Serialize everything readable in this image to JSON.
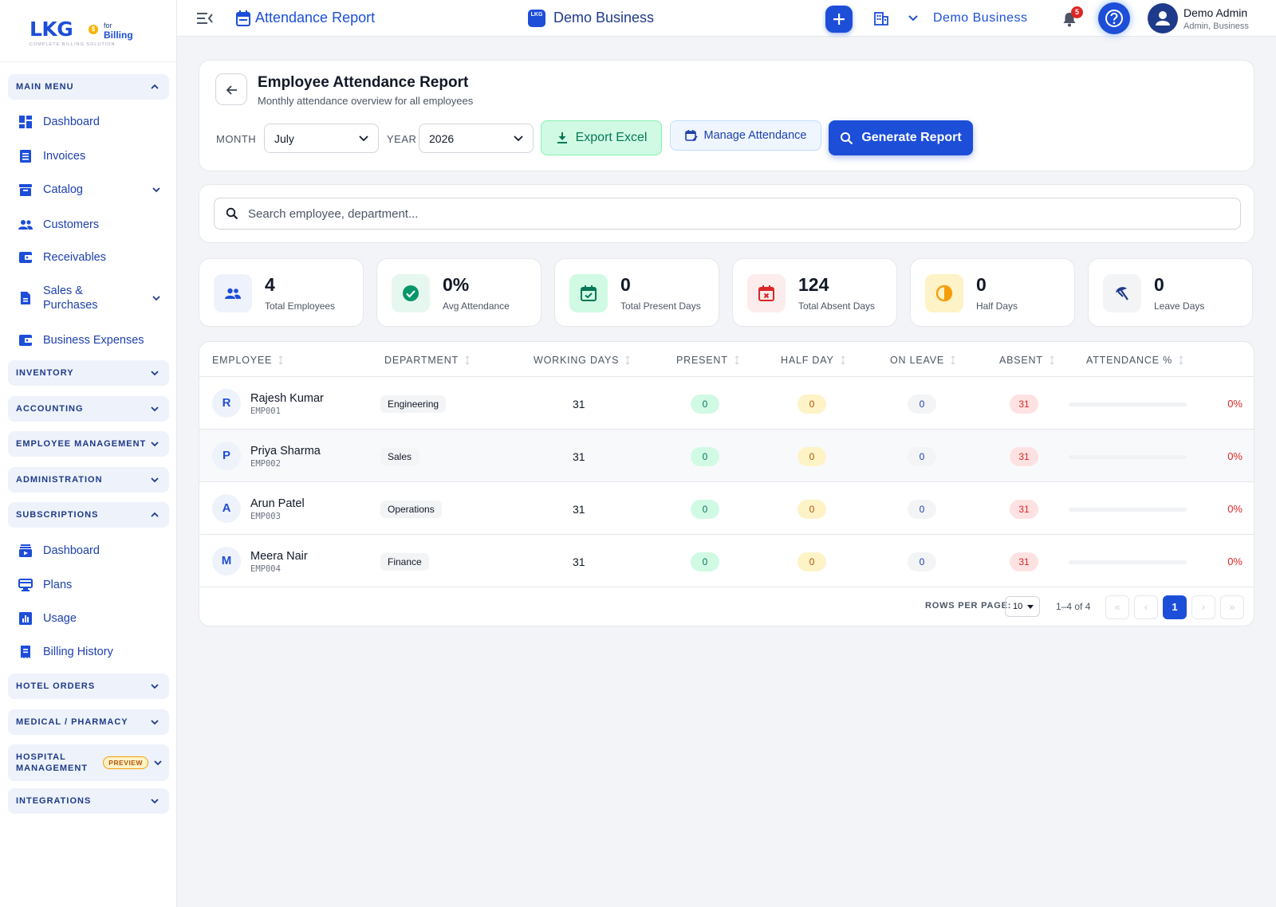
{
  "brand": {
    "logo_text": "LKG",
    "coin_glyph": "$",
    "for_text": "for",
    "billing_text": "Billing",
    "tagline": "COMPLETE BILLING SOLUTION"
  },
  "sidebar": {
    "main_menu": "MAIN MENU",
    "items": [
      {
        "label": "Dashboard",
        "icon": "dashboard-icon"
      },
      {
        "label": "Invoices",
        "icon": "invoice-icon"
      },
      {
        "label": "Catalog",
        "icon": "catalog-icon"
      },
      {
        "label": "Customers",
        "icon": "customers-icon"
      },
      {
        "label": "Receivables",
        "icon": "wallet-icon"
      },
      {
        "label": "Sales &",
        "label2": "Purchases",
        "icon": "document-icon"
      },
      {
        "label": "Business Expenses",
        "icon": "wallet-icon"
      }
    ],
    "sections": {
      "inventory": "INVENTORY",
      "accounting": "ACCOUNTING",
      "employee": "EMPLOYEE MANAGEMENT",
      "administration": "ADMINISTRATION",
      "subscriptions": "SUBSCRIPTIONS",
      "hotel": "HOTEL ORDERS",
      "medical": "MEDICAL / PHARMACY",
      "hospital_1": "HOSPITAL",
      "hospital_2": "MANAGEMENT",
      "hospital_badge": "PREVIEW",
      "integrations": "INTEGRATIONS"
    },
    "sub_items": [
      {
        "label": "Dashboard",
        "icon": "subscription-dashboard-icon"
      },
      {
        "label": "Plans",
        "icon": "plans-icon"
      },
      {
        "label": "Usage",
        "icon": "usage-chart-icon"
      },
      {
        "label": "Billing History",
        "icon": "receipt-icon"
      }
    ]
  },
  "topbar": {
    "page_title": "Attendance Report",
    "business_center": "Demo Business",
    "business_logo_text": "LKG",
    "business_selector": "Demo Business",
    "notification_count": "5",
    "user_name": "Demo Admin",
    "user_role": "Admin, Business"
  },
  "header": {
    "title": "Employee Attendance Report",
    "subtitle": "Monthly attendance overview for all employees",
    "month_label": "MONTH",
    "month_value": "July",
    "year_label": "YEAR",
    "year_value": "2026",
    "export_label": "Export Excel",
    "manage_label": "Manage Attendance",
    "generate_label": "Generate Report"
  },
  "search": {
    "placeholder": "Search employee, department..."
  },
  "stats": [
    {
      "value": "4",
      "label": "Total Employees",
      "icon": "people-icon"
    },
    {
      "value": "0%",
      "label": "Avg Attendance",
      "icon": "check-circle-icon"
    },
    {
      "value": "0",
      "label": "Total Present Days",
      "icon": "calendar-check-icon"
    },
    {
      "value": "124",
      "label": "Total Absent Days",
      "icon": "calendar-x-icon"
    },
    {
      "value": "0",
      "label": "Half Days",
      "icon": "half-circle-icon"
    },
    {
      "value": "0",
      "label": "Leave Days",
      "icon": "beach-umbrella-icon"
    }
  ],
  "table": {
    "columns": [
      "EMPLOYEE",
      "DEPARTMENT",
      "WORKING DAYS",
      "PRESENT",
      "HALF DAY",
      "ON LEAVE",
      "ABSENT",
      "ATTENDANCE %"
    ],
    "rows": [
      {
        "initial": "R",
        "name": "Rajesh Kumar",
        "code": "EMP001",
        "department": "Engineering",
        "working": "31",
        "present": "0",
        "half": "0",
        "leave": "0",
        "absent": "31",
        "pct": "0%",
        "pct_value": 0
      },
      {
        "initial": "P",
        "name": "Priya Sharma",
        "code": "EMP002",
        "department": "Sales",
        "working": "31",
        "present": "0",
        "half": "0",
        "leave": "0",
        "absent": "31",
        "pct": "0%",
        "pct_value": 0
      },
      {
        "initial": "A",
        "name": "Arun Patel",
        "code": "EMP003",
        "department": "Operations",
        "working": "31",
        "present": "0",
        "half": "0",
        "leave": "0",
        "absent": "31",
        "pct": "0%",
        "pct_value": 0
      },
      {
        "initial": "M",
        "name": "Meera Nair",
        "code": "EMP004",
        "department": "Finance",
        "working": "31",
        "present": "0",
        "half": "0",
        "leave": "0",
        "absent": "31",
        "pct": "0%",
        "pct_value": 0
      }
    ]
  },
  "pagination": {
    "rows_label": "ROWS PER PAGE:",
    "rows_value": "10",
    "range": "1–4 of 4",
    "first": "«",
    "prev": "‹",
    "page": "1",
    "next": "›",
    "last": "»"
  },
  "colors": {
    "primary": "#1d4ed8",
    "success": "#047857",
    "danger": "#dc2626",
    "warning": "#f59e0b"
  }
}
